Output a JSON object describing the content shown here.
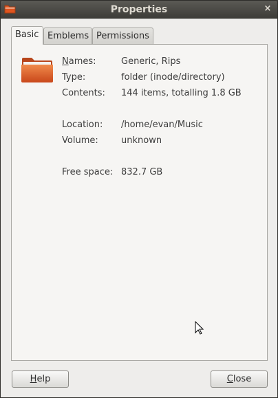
{
  "window": {
    "title": "Properties",
    "close_glyph": "×"
  },
  "tabs": [
    {
      "label": "Basic",
      "active": true
    },
    {
      "label": "Emblems",
      "active": false
    },
    {
      "label": "Permissions",
      "active": false
    }
  ],
  "icon": {
    "name": "folder-icon",
    "color": "#e0551f"
  },
  "properties": {
    "names": {
      "label_first": "N",
      "label_rest": "ames:",
      "value": "Generic, Rips"
    },
    "type": {
      "label": "Type:",
      "value": "folder (inode/directory)"
    },
    "contents": {
      "label": "Contents:",
      "value": "144 items, totalling 1.8 GB"
    },
    "location": {
      "label": "Location:",
      "value": "/home/evan/Music"
    },
    "volume": {
      "label": "Volume:",
      "value": "unknown"
    },
    "free_space": {
      "label": "Free space:",
      "value": "832.7 GB"
    }
  },
  "buttons": {
    "help": {
      "first": "H",
      "rest": "elp"
    },
    "close": {
      "first": "C",
      "rest": "lose"
    }
  }
}
